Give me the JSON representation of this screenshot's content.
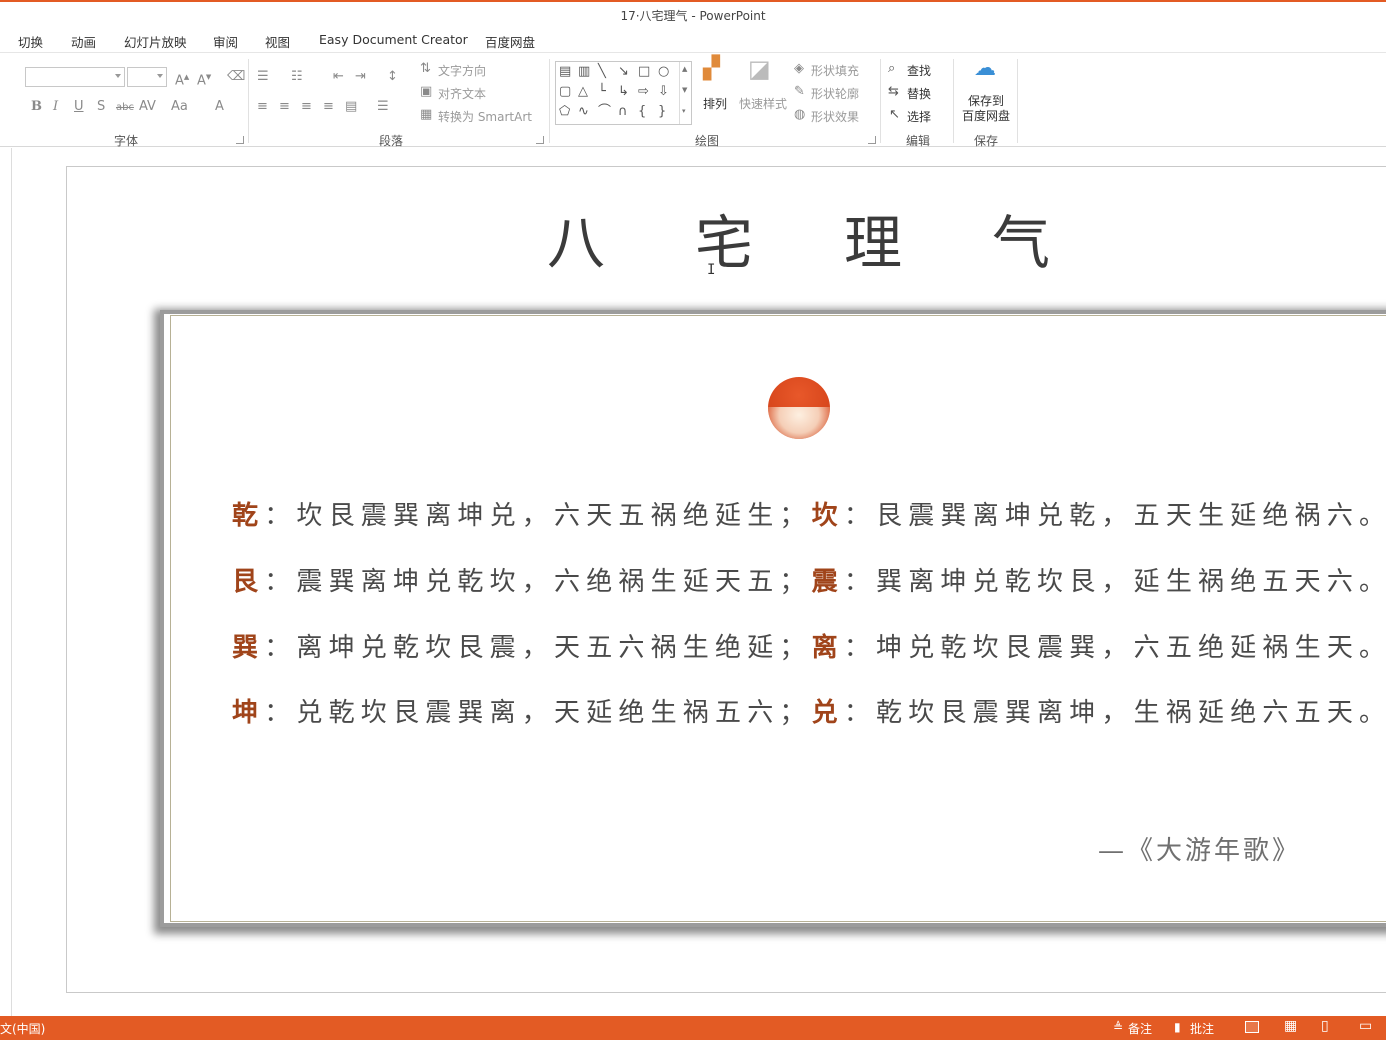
{
  "window": {
    "title": "17·八宅理气 - PowerPoint"
  },
  "tabs": [
    "切换",
    "动画",
    "幻灯片放映",
    "审阅",
    "视图",
    "Easy Document Creator",
    "百度网盘"
  ],
  "ribbon": {
    "font_group": {
      "label": "字体"
    },
    "paragraph_group": {
      "label": "段落",
      "text_direction": "文字方向",
      "align_text": "对齐文本",
      "convert_smartart": "转换为 SmartArt"
    },
    "drawing_group": {
      "label": "绘图",
      "arrange": "排列",
      "quick_styles": "快速样式",
      "shape_fill": "形状填充",
      "shape_outline": "形状轮廓",
      "shape_effects": "形状效果"
    },
    "editing_group": {
      "label": "编辑",
      "find": "查找",
      "replace": "替换",
      "select": "选择"
    },
    "save_group": {
      "label": "保存",
      "save_to_baidu": "保存到\n百度网盘"
    }
  },
  "slide": {
    "title_chars": [
      "八",
      "宅",
      "理",
      "气"
    ],
    "verses": [
      {
        "key1": "乾",
        "text1": "：坎艮震巽离坤兑，六天五祸绝延生；",
        "key2": "坎",
        "text2": "：艮震巽离坤兑乾，五天生延绝祸六。"
      },
      {
        "key1": "艮",
        "text1": "：震巽离坤兑乾坎，六绝祸生延天五；",
        "key2": "震",
        "text2": "：巽离坤兑乾坎艮，延生祸绝五天六。"
      },
      {
        "key1": "巽",
        "text1": "：离坤兑乾坎艮震，天五六祸生绝延；",
        "key2": "离",
        "text2": "：坤兑乾坎艮震巽，六五绝延祸生天。"
      },
      {
        "key1": "坤",
        "text1": "：兑乾坎艮震巽离，天延绝生祸五六；",
        "key2": "兑",
        "text2": "：乾坎艮震巽离坤，生祸延绝六五天。"
      }
    ],
    "source": "—《大游年歌》"
  },
  "statusbar": {
    "language": "文(中国)",
    "notes": "备注",
    "comments": "批注"
  },
  "colors": {
    "accent": "#e35b24",
    "key_text": "#a0441a",
    "sun": "#d9481d"
  }
}
